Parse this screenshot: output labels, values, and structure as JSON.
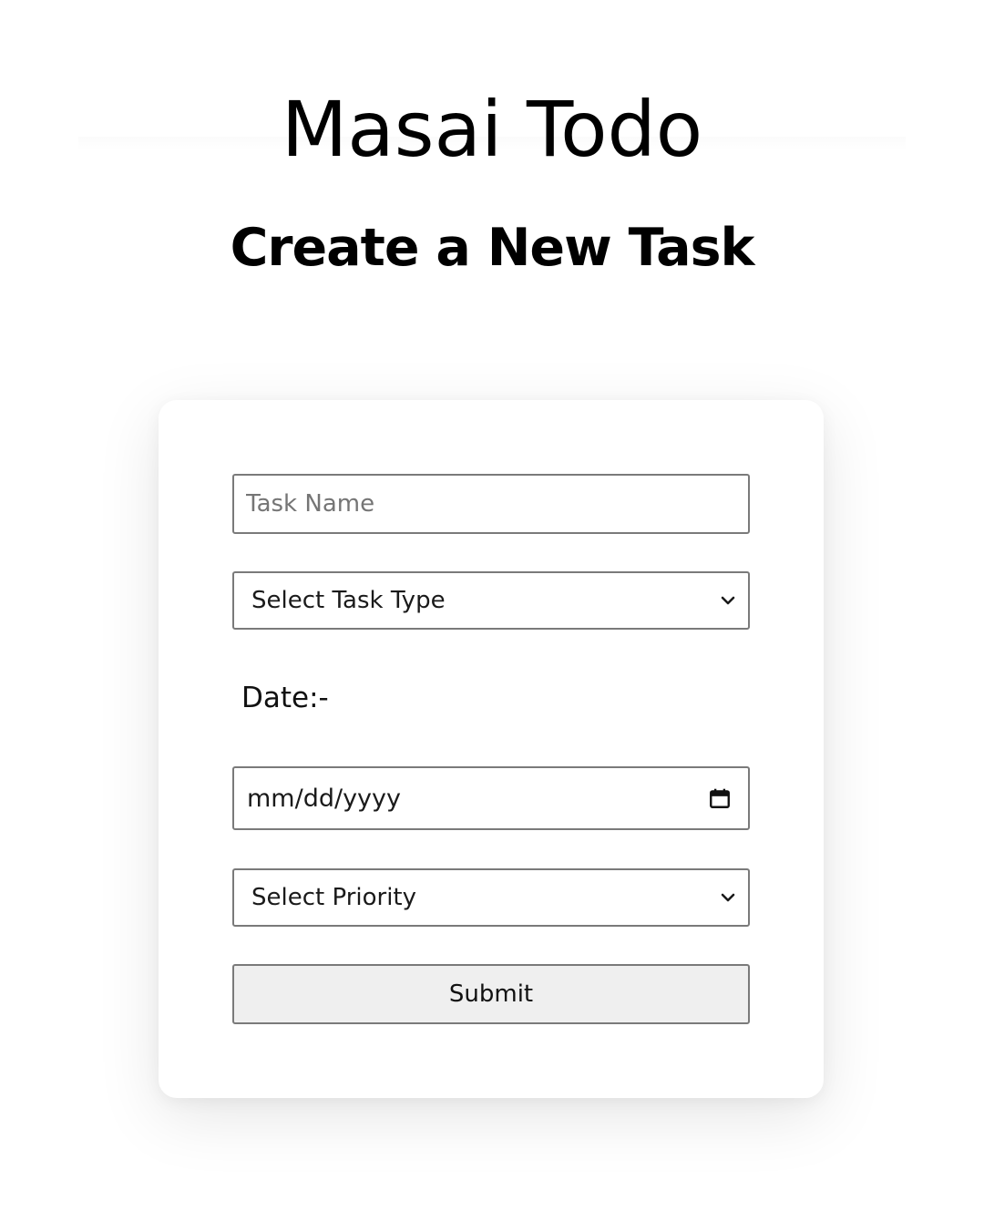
{
  "header": {
    "app_title": "Masai Todo"
  },
  "form": {
    "heading": "Create a New Task",
    "task_name": {
      "value": "",
      "placeholder": "Task Name"
    },
    "task_type": {
      "selected": "Select Task Type",
      "icon": "chevron-down-icon"
    },
    "date_label": "Date:-",
    "date_input": {
      "value": "mm/dd/yyyy",
      "icon": "calendar-icon"
    },
    "priority": {
      "selected": "Select Priority",
      "icon": "chevron-down-icon"
    },
    "submit_label": "Submit"
  },
  "colors": {
    "background": "#ffffff",
    "text": "#000000",
    "field_border": "#7a7a7a",
    "button_background": "#efefef",
    "placeholder": "#757575"
  }
}
